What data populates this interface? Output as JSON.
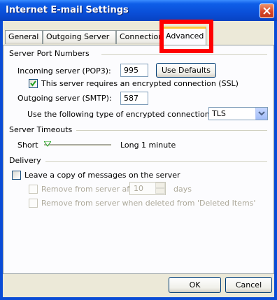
{
  "window": {
    "title": "Internet E-mail Settings"
  },
  "tabs": [
    {
      "label": "General"
    },
    {
      "label": "Outgoing Server"
    },
    {
      "label": "Connection"
    },
    {
      "label": "Advanced"
    }
  ],
  "server_ports": {
    "group_label": "Server Port Numbers",
    "incoming_label": "Incoming server (POP3):",
    "incoming_value": "995",
    "use_defaults_label": "Use Defaults",
    "ssl_label": "This server requires an encrypted connection (SSL)",
    "ssl_checked": true,
    "outgoing_label": "Outgoing server (SMTP):",
    "outgoing_value": "587",
    "encryption_label": "Use the following type of encrypted connection:",
    "encryption_value": "TLS"
  },
  "timeouts": {
    "group_label": "Server Timeouts",
    "short_label": "Short",
    "long_label": "Long",
    "value_label": "1 minute"
  },
  "delivery": {
    "group_label": "Delivery",
    "leave_copy_label": "Leave a copy of messages on the server",
    "leave_copy_checked": false,
    "remove_after_label": "Remove from server after",
    "remove_after_value": "10",
    "days_label": "days",
    "remove_deleted_label": "Remove from server when deleted from 'Deleted Items'"
  },
  "buttons": {
    "ok_label": "OK",
    "cancel_label": "Cancel"
  },
  "colors": {
    "titlebar": "#0a4cd6",
    "highlight": "#ff0000",
    "tab_accent": "#ffc83c",
    "dialog_bg": "#ece9d8"
  }
}
